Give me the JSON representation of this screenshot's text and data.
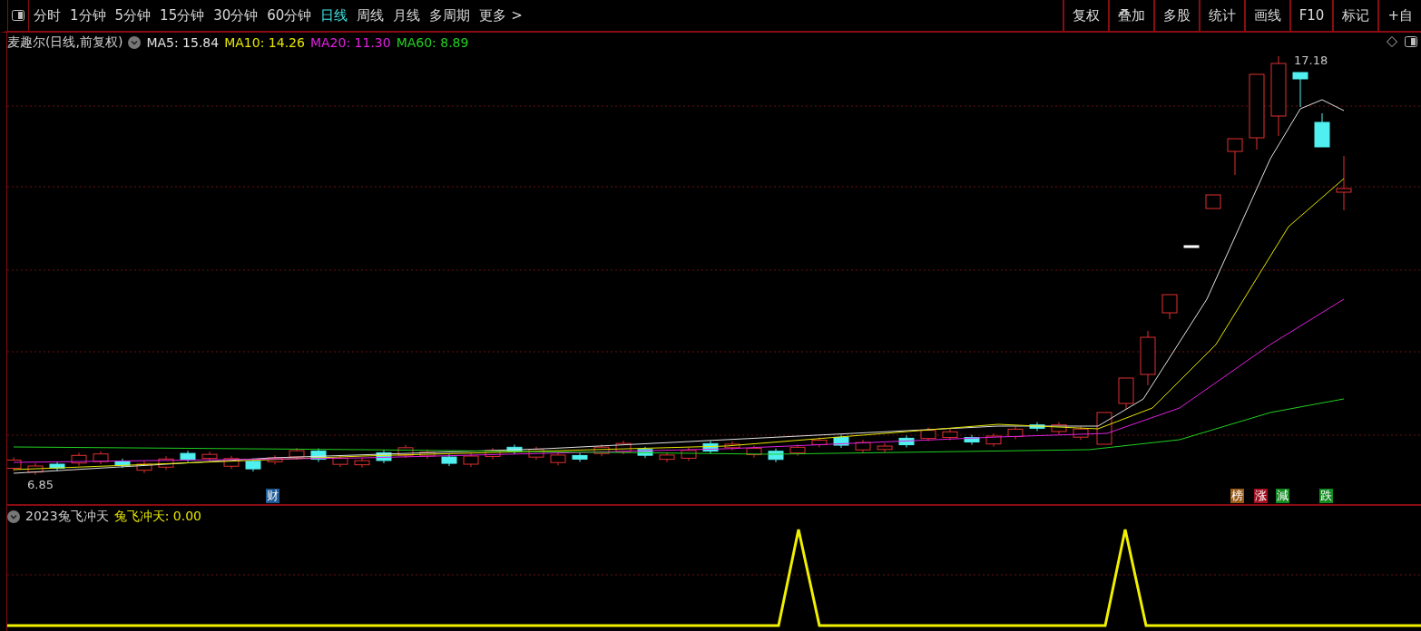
{
  "toolbar": {
    "periods": [
      {
        "label": "分时",
        "selected": false
      },
      {
        "label": "1分钟",
        "selected": false
      },
      {
        "label": "5分钟",
        "selected": false
      },
      {
        "label": "15分钟",
        "selected": false
      },
      {
        "label": "30分钟",
        "selected": false
      },
      {
        "label": "60分钟",
        "selected": false
      },
      {
        "label": "日线",
        "selected": true
      },
      {
        "label": "周线",
        "selected": false
      },
      {
        "label": "月线",
        "selected": false
      },
      {
        "label": "多周期",
        "selected": false
      },
      {
        "label": "更多 >",
        "selected": false
      }
    ],
    "tools": [
      "复权",
      "叠加",
      "多股",
      "统计",
      "画线",
      "F10",
      "标记",
      "+自"
    ]
  },
  "main_chart": {
    "title": "麦趣尔(日线,前复权)",
    "legend": [
      {
        "label": "MA5: 15.84",
        "color": "#e0e0e0"
      },
      {
        "label": "MA10: 14.26",
        "color": "#e6e600"
      },
      {
        "label": "MA20: 11.30",
        "color": "#e020e0"
      },
      {
        "label": "MA60: 8.89",
        "color": "#20d020"
      }
    ],
    "high_label": "17.18",
    "low_label": "6.85",
    "report_marker": {
      "label": "财",
      "color": "#1e5a96"
    },
    "events": [
      {
        "label": "榜",
        "color": "#9a5a18"
      },
      {
        "label": "涨",
        "color": "#a01020"
      },
      {
        "label": "減",
        "color": "#128a20"
      },
      {
        "label": "跌",
        "color": "#128a20"
      }
    ]
  },
  "indicator": {
    "name": "2023兔飞冲天",
    "value": "兔飞冲天: 0.00"
  }
}
